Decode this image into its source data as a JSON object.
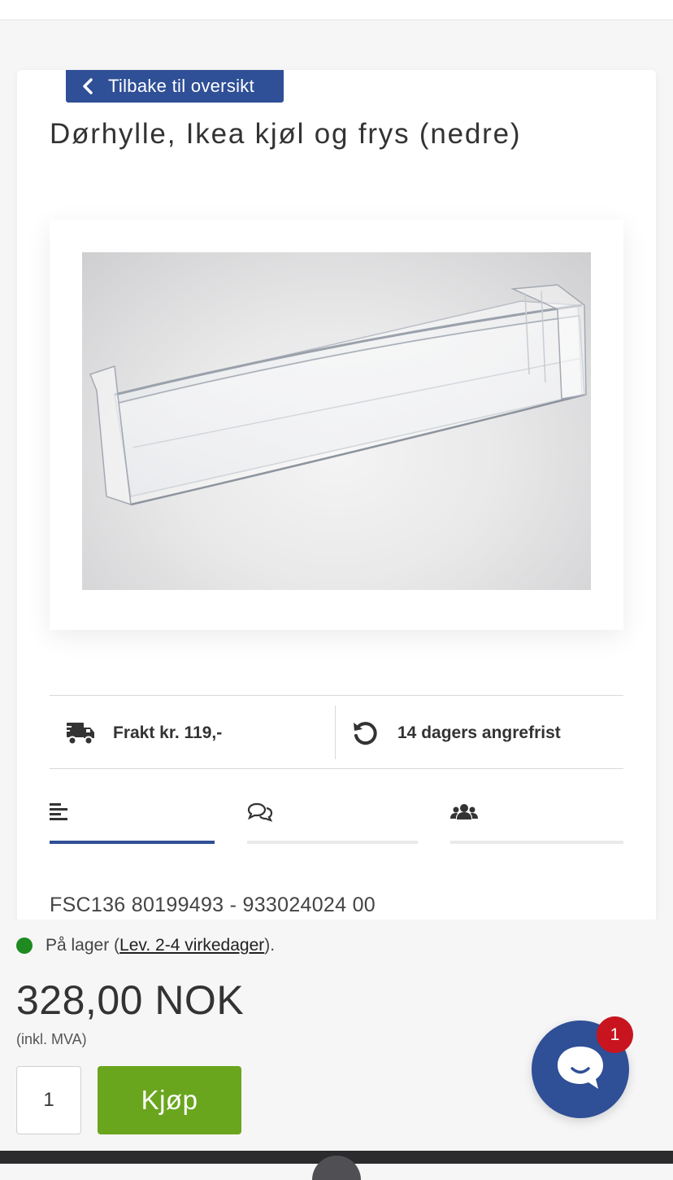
{
  "navigation": {
    "back_label": "Tilbake til oversikt"
  },
  "product": {
    "title": "Dørhylle, Ikea kjøl og frys (nedre)",
    "sku_text": "FSC136 80199493 - 933024024 00",
    "image_alt": "Transparent door shelf"
  },
  "features": [
    {
      "icon": "truck-icon",
      "label": "Frakt kr. 119,-"
    },
    {
      "icon": "undo-icon",
      "label": "14 dagers angrefrist"
    }
  ],
  "tabs": [
    {
      "icon": "align-left-icon",
      "active": true
    },
    {
      "icon": "comments-icon",
      "active": false
    },
    {
      "icon": "users-icon",
      "active": false
    }
  ],
  "purchase": {
    "stock_prefix": "På lager (",
    "stock_link": "Lev. 2-4 virkedager",
    "stock_suffix": ").",
    "price": "328,00 NOK",
    "vat_note": "(inkl. MVA)",
    "quantity": "1",
    "buy_label": "Kjøp"
  },
  "chat": {
    "badge_count": "1"
  },
  "colors": {
    "brand_blue": "#2f4f96",
    "buy_green": "#6aa51e",
    "stock_green": "#1f8a1f",
    "badge_red": "#c8141e"
  }
}
